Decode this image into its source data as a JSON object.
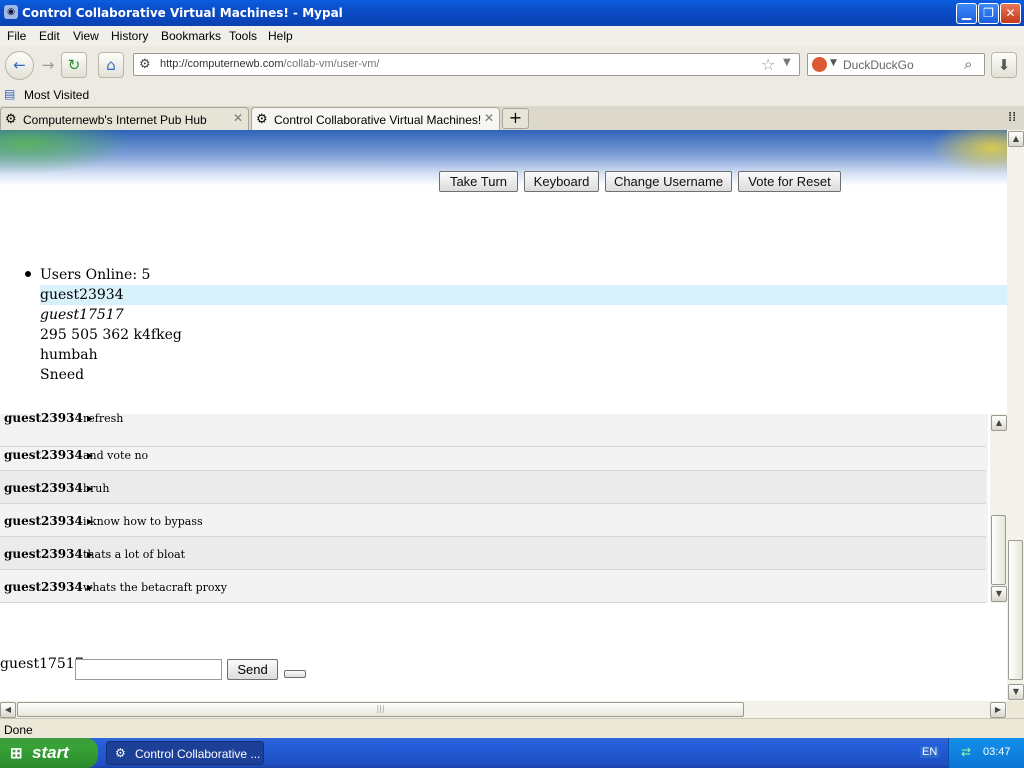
{
  "window": {
    "title": "Control Collaborative Virtual Machines! - Mypal"
  },
  "menu": [
    "File",
    "Edit",
    "View",
    "History",
    "Bookmarks",
    "Tools",
    "Help"
  ],
  "url": {
    "host": "http://computernewb.com",
    "path": "/collab-vm/user-vm/"
  },
  "search": {
    "engine": "DuckDuckGo"
  },
  "bookmarks": {
    "most_visited": "Most Visited"
  },
  "tabs": [
    {
      "label": "Computernewb's Internet Pub Hub"
    },
    {
      "label": "Control Collaborative Virtual Machines!"
    }
  ],
  "page": {
    "buttons": {
      "take_turn": "Take Turn",
      "keyboard": "Keyboard",
      "change_username": "Change Username",
      "vote_reset": "Vote for Reset"
    },
    "users_online": "Users Online: 5",
    "users": [
      "guest23934",
      "guest17517",
      "295 505 362 k4fkeg",
      "humbah",
      "Sneed"
    ],
    "chat": [
      {
        "user": "guest23934",
        "message": "refresh"
      },
      {
        "user": "guest23934",
        "message": "and vote no"
      },
      {
        "user": "guest23934",
        "message": "bruh"
      },
      {
        "user": "guest23934",
        "message": "i know how to bypass"
      },
      {
        "user": "guest23934",
        "message": "thats a lot of bloat"
      },
      {
        "user": "guest23934",
        "message": "whats the betacraft proxy"
      }
    ],
    "chat_username": "guest17517",
    "chat_input_value": "",
    "send_label": "Send"
  },
  "status": {
    "text": "Done"
  },
  "taskbar": {
    "start": "start",
    "item": "Control Collaborative ...",
    "lang": "EN",
    "clock": "03:47"
  },
  "colors": {
    "titlebar": "#0b4cc8",
    "highlight_row": "#d9f1fa",
    "start_green": "#37a337"
  }
}
